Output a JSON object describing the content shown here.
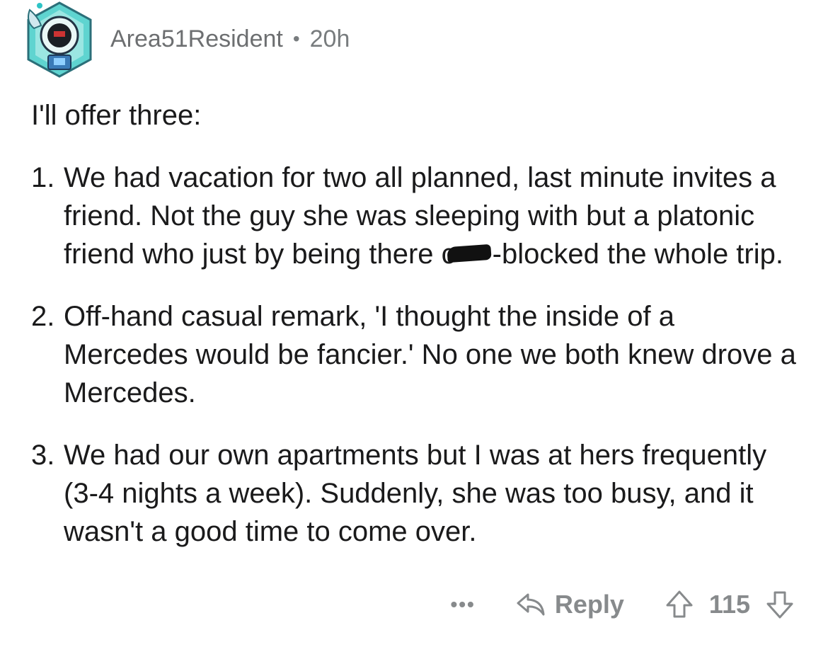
{
  "comment": {
    "author": "Area51Resident",
    "separator": "•",
    "age": "20h",
    "intro": "I'll offer three:",
    "items": [
      {
        "num": "1.",
        "text_before": "We had vacation for two all planned, last minute invites a friend. Not the guy she was sleeping with but a platonic friend who just by being there c",
        "text_after": "-blocked the whole trip."
      },
      {
        "num": "2.",
        "text": "Off-hand casual remark, 'I thought the inside of a Mercedes would be fancier.' No one we both knew drove a Mercedes."
      },
      {
        "num": "3.",
        "text": "We had our own apartments but I was at hers frequently (3-4 nights a week). Suddenly, she was too busy, and it wasn't a good time to come over."
      }
    ]
  },
  "actions": {
    "more_label": "•••",
    "reply_label": "Reply",
    "score": "115"
  },
  "icons": {
    "avatar": "robot-avatar-icon",
    "reply": "reply-arrow-icon",
    "upvote": "upvote-arrow-icon",
    "downvote": "downvote-arrow-icon"
  },
  "colors": {
    "text": "#1a1a1b",
    "meta": "#787c7e",
    "action": "#878a8c",
    "avatar_teal": "#2ec4c6"
  }
}
